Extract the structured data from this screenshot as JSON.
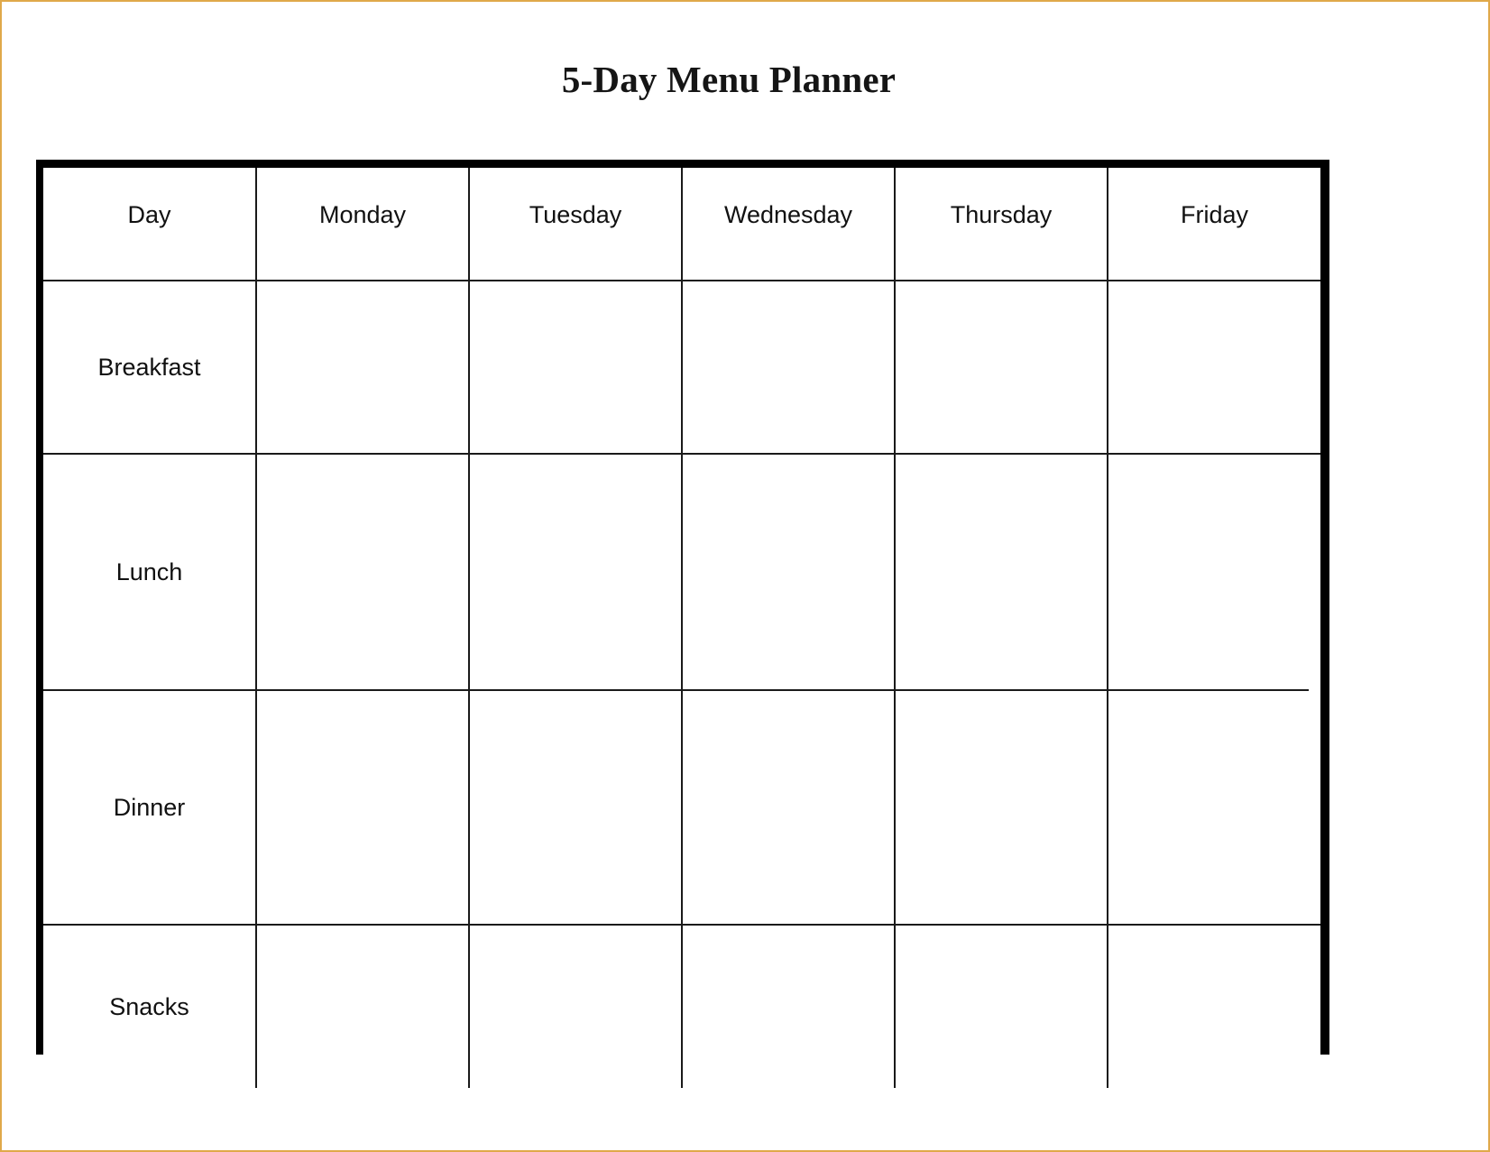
{
  "document": {
    "title": "5-Day Menu Planner",
    "border_color": "#e0a94a",
    "frame_color": "#000000",
    "rule_color": "#1a1a1a",
    "background": "#ffffff"
  },
  "table": {
    "columns": [
      {
        "key": "day",
        "label": "Day"
      },
      {
        "key": "monday",
        "label": "Monday"
      },
      {
        "key": "tuesday",
        "label": "Tuesday"
      },
      {
        "key": "wednesday",
        "label": "Wednesday"
      },
      {
        "key": "thursday",
        "label": "Thursday"
      },
      {
        "key": "friday",
        "label": "Friday"
      }
    ],
    "rows": [
      {
        "label": "Breakfast",
        "cells": [
          "",
          "",
          "",
          "",
          ""
        ]
      },
      {
        "label": "Lunch",
        "cells": [
          "",
          "",
          "",
          "",
          ""
        ]
      },
      {
        "label": "Dinner",
        "cells": [
          "",
          "",
          "",
          "",
          ""
        ]
      },
      {
        "label": "Snacks",
        "cells": [
          "",
          "",
          "",
          "",
          ""
        ]
      }
    ]
  }
}
